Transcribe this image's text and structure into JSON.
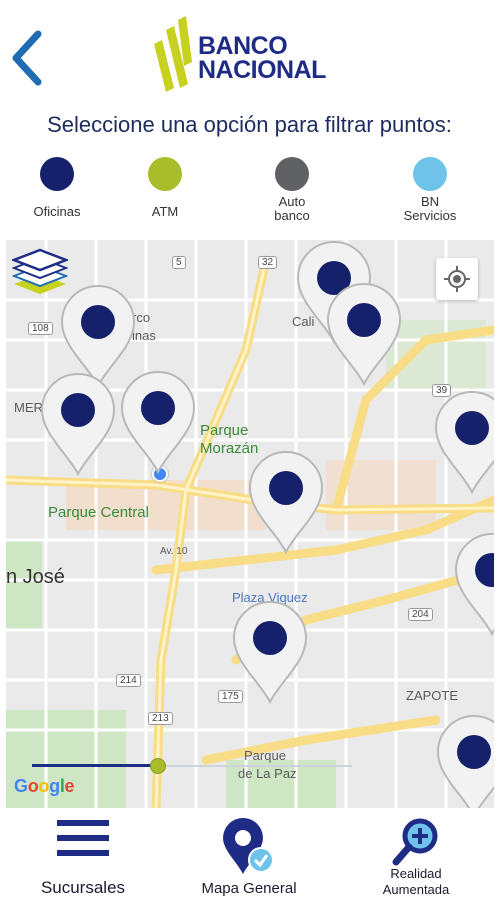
{
  "header": {
    "logo_line1": "BANCO",
    "logo_line2": "NACIONAL"
  },
  "filter_title": "Seleccione una opción para filtrar puntos:",
  "filters": [
    {
      "label": "Oficinas",
      "color": "#15226b"
    },
    {
      "label": "ATM",
      "color": "#a9bd2a"
    },
    {
      "label_l1": "Auto",
      "label_l2": "banco",
      "color": "#606164"
    },
    {
      "label_l1": "BN",
      "label_l2": "Servicios",
      "color": "#6fc3ea"
    }
  ],
  "map": {
    "labels": {
      "parque_morazan_l1": "Parque",
      "parque_morazan_l2": "Morazán",
      "parque_central": "Parque Central",
      "san_jose": "n José",
      "plaza_viquez": "Plaza Viquez",
      "zapote": "ZAPOTE",
      "merced": "MER",
      "barrio_l1": "rco",
      "barrio_l2": "inas",
      "cali": "Cali",
      "av10": "Av. 10",
      "parque_paz_l1": "Parque",
      "parque_paz_l2": "de La Paz"
    },
    "route_shields": [
      "5",
      "32",
      "108",
      "39",
      "204",
      "214",
      "175",
      "213"
    ],
    "slider_value": 0.39,
    "attribution": "Google",
    "pin_color": "#15226b"
  },
  "bottom_nav": {
    "sucursales": "Sucursales",
    "mapa_general": "Mapa General",
    "realidad_l1": "Realidad",
    "realidad_l2": "Aumentada"
  }
}
